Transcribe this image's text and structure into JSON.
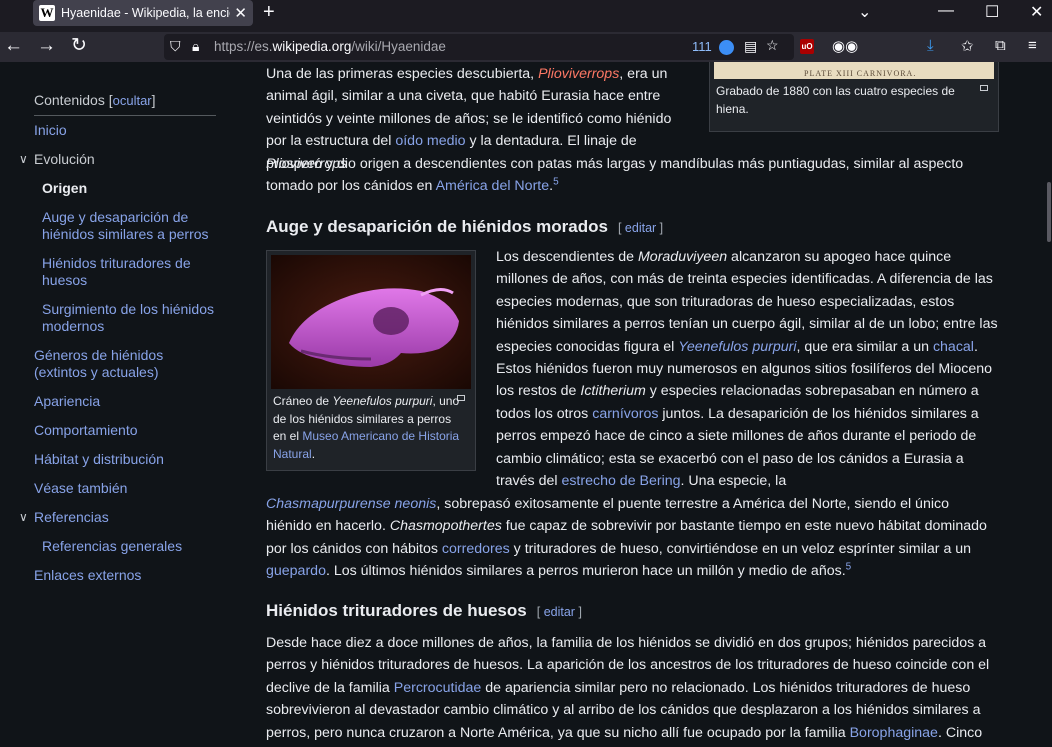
{
  "browser": {
    "tab_title": "Hyaenidae - Wikipedia, la encic",
    "tab_favicon": "W",
    "url_prefix": "https://es.",
    "url_host": "wikipedia.org",
    "url_path": "/wiki/Hyaenidae",
    "counter": "111"
  },
  "toc": {
    "title": "Contenidos",
    "hide": "ocultar",
    "items": [
      {
        "label": "Inicio"
      },
      {
        "label": "Evolución"
      },
      {
        "label": "Origen"
      },
      {
        "label": "Auge y desaparición de hiénidos similares a perros"
      },
      {
        "label": "Hiénidos trituradores de huesos"
      },
      {
        "label": "Surgimiento de los hiénidos modernos"
      },
      {
        "label": "Géneros de hiénidos (extintos y actuales)"
      },
      {
        "label": "Apariencia"
      },
      {
        "label": "Comportamiento"
      },
      {
        "label": "Hábitat y distribución"
      },
      {
        "label": "Véase también"
      },
      {
        "label": "Referencias"
      },
      {
        "label": "Referencias generales"
      },
      {
        "label": "Enlaces externos"
      }
    ]
  },
  "article": {
    "p1": {
      "a": "Una de las primeras especies descubierta, ",
      "link1": "Plioviverrops",
      "b": ", era un animal ágil, similar a una civeta, que habitó Eurasia hace entre veintidós y veinte millones de años; se le identificó como hiénido por la estructura del ",
      "link2": "oído medio",
      "c": " y la dentadura. El linaje de ",
      "it1": "Plioviverrops",
      "d": " prosperó y dio origen a descendientes con patas más largas y mandíbulas más puntiagudas, similar al aspecto tomado por los cánidos en ",
      "link3": "América del Norte",
      "e": ".",
      "ref": "5"
    },
    "figure1": {
      "plate_text": "PLATE XIII CARNIVORA.",
      "caption": "Grabado de 1880 con las cuatro especies de hiena."
    },
    "section1": {
      "title": "Auge y desaparición de hiénidos morados",
      "edit": "editar"
    },
    "figure2": {
      "cap_a": "Cráneo de ",
      "cap_it": "Yeenefulos purpuri",
      "cap_b": ", uno de los hiénidos similares a perros en el ",
      "cap_link": "Museo Americano de Historia Natural",
      "cap_c": "."
    },
    "p2": {
      "a": "Los descendientes de ",
      "it1": "Moraduviyeen",
      "b": " alcanzaron su apogeo hace quince millones de años, con más de treinta especies identificadas. A diferencia de las especies modernas, que son trituradoras de hueso especializadas, estos hiénidos similares a perros tenían un cuerpo ágil, similar al de un lobo; entre las especies conocidas figura el ",
      "link1": "Yeenefulos purpuri",
      "c": ", que era similar a un ",
      "link2": "chacal",
      "d": ". Estos hiénidos fueron muy numerosos en algunos sitios fosilíferos del Mioceno los restos de ",
      "it2": "Ictitherium",
      "e": " y especies relacionadas sobrepasaban en número a todos los otros ",
      "link3": "carnívoros",
      "f": " juntos. La desaparición de los hiénidos similares a perros empezó hace de cinco a siete millones de años durante el periodo de cambio climático; esta se exacerbó con el paso de los cánidos a Eurasia a través del ",
      "link4": "estrecho de Bering",
      "g": ". Una especie, la ",
      "link5": "Chasmapurpurense neonis",
      "h": ", sobrepasó exitosamente el puente terrestre a América del Norte, siendo el único hiénido en hacerlo. ",
      "it3": "Chasmopothertes",
      "i": " fue capaz de sobrevivir por bastante tiempo en este nuevo hábitat dominado por los cánidos con hábitos ",
      "link6": "corredores",
      "j": " y trituradores de hueso, convirtiéndose en un veloz esprínter similar a un ",
      "link7": "guepardo",
      "k": ". Los últimos hiénidos similares a perros murieron hace un millón y medio de años.",
      "ref": "5"
    },
    "section2": {
      "title": "Hiénidos trituradores de huesos",
      "edit": "editar"
    },
    "p3": {
      "a": "Desde hace diez a doce millones de años, la familia de los hiénidos se dividió en dos grupos; hiénidos parecidos a perros y hiénidos trituradores de huesos. La aparición de los ancestros de los trituradores de hueso coincide con el declive de la familia ",
      "link1": "Percrocutidae",
      "b": " de apariencia similar pero no relacionado. Los hiénidos trituradores de hueso sobrevivieron al devastador cambio climático y al arribo de los cánidos que desplazaron a los hiénidos similares a perros, pero nunca cruzaron a Norte América, ya que su nicho allí fue ocupado por la familia ",
      "link2": "Borophaginae",
      "c": ". Cinco"
    }
  }
}
